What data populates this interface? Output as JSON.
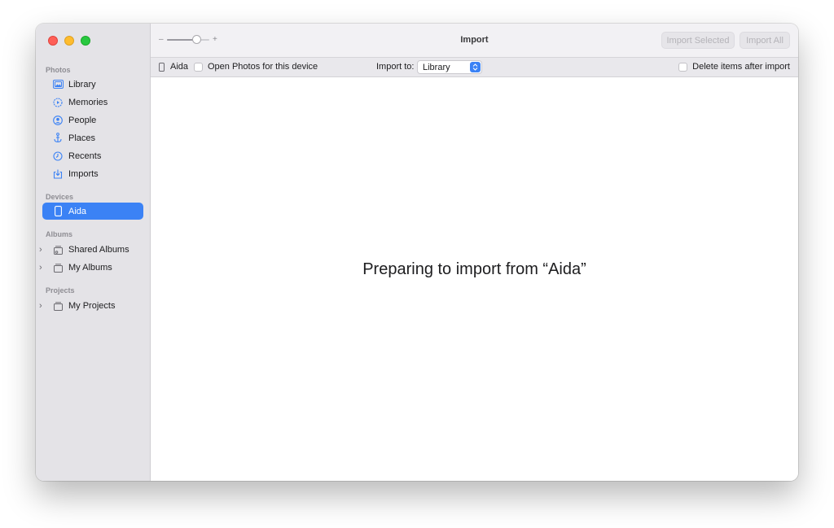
{
  "window": {
    "title": "Import"
  },
  "toolbar": {
    "zoom_minus": "–",
    "zoom_plus": "+",
    "zoom_level": 0.7,
    "import_selected_label": "Import Selected",
    "import_all_label": "Import All"
  },
  "sidebar": {
    "sections": {
      "photos": "Photos",
      "devices": "Devices",
      "albums": "Albums",
      "projects": "Projects"
    },
    "photos_items": [
      {
        "label": "Library",
        "icon": "library-icon"
      },
      {
        "label": "Memories",
        "icon": "memories-icon"
      },
      {
        "label": "People",
        "icon": "people-icon"
      },
      {
        "label": "Places",
        "icon": "places-icon"
      },
      {
        "label": "Recents",
        "icon": "recents-icon"
      },
      {
        "label": "Imports",
        "icon": "imports-icon"
      }
    ],
    "device_items": [
      {
        "label": "Aida",
        "icon": "phone-icon",
        "selected": true
      }
    ],
    "album_items": [
      {
        "label": "Shared Albums",
        "icon": "shared-albums-icon"
      },
      {
        "label": "My Albums",
        "icon": "album-icon"
      }
    ],
    "project_items": [
      {
        "label": "My Projects",
        "icon": "projects-icon"
      }
    ]
  },
  "importbar": {
    "device_name": "Aida",
    "open_photos_label": "Open Photos for this device",
    "import_to_label": "Import to:",
    "import_to_value": "Library",
    "delete_after_label": "Delete items after import"
  },
  "main": {
    "message": "Preparing to import from “Aida”"
  },
  "colors": {
    "accent": "#3b82f5",
    "sidebar_bg": "#e4e3e7",
    "close": "#fe5f57",
    "minimize": "#febc2e",
    "zoom": "#28c840"
  }
}
